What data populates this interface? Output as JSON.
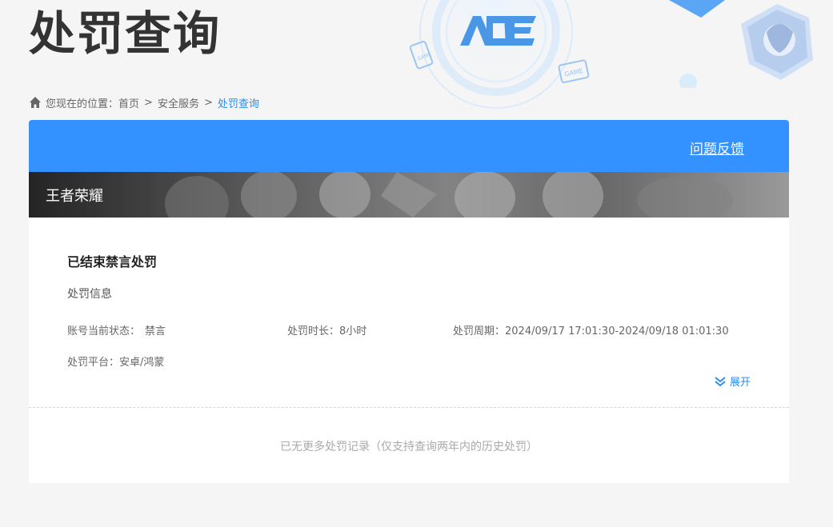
{
  "page": {
    "title": "处罚查询"
  },
  "breadcrumb": {
    "prefix": "您现在的位置：",
    "items": [
      "首页",
      "安全服务",
      "处罚查询"
    ],
    "separator": ">"
  },
  "header": {
    "feedback_label": "问题反馈"
  },
  "game": {
    "name": "王者荣耀"
  },
  "record": {
    "title": "已结束禁言处罚",
    "section_label": "处罚信息",
    "status_label": "账号当前状态：",
    "status_value": "禁言",
    "duration_label": "处罚时长：",
    "duration_value": "8小时",
    "period_label": "处罚周期：",
    "period_value": "2024/09/17 17:01:30-2024/09/18 01:01:30",
    "platform_label": "处罚平台：",
    "platform_value": "安卓/鸿蒙",
    "expand_label": "展开"
  },
  "footer": {
    "no_more_text": "已无更多处罚记录（仅支持查询两年内的历史处罚）"
  },
  "colors": {
    "accent_blue": "#3392ff",
    "link_blue": "#2d8cf0",
    "background": "#f5f5f5"
  },
  "icons": {
    "home": "home-icon",
    "expand": "double-chevron-down-icon"
  }
}
